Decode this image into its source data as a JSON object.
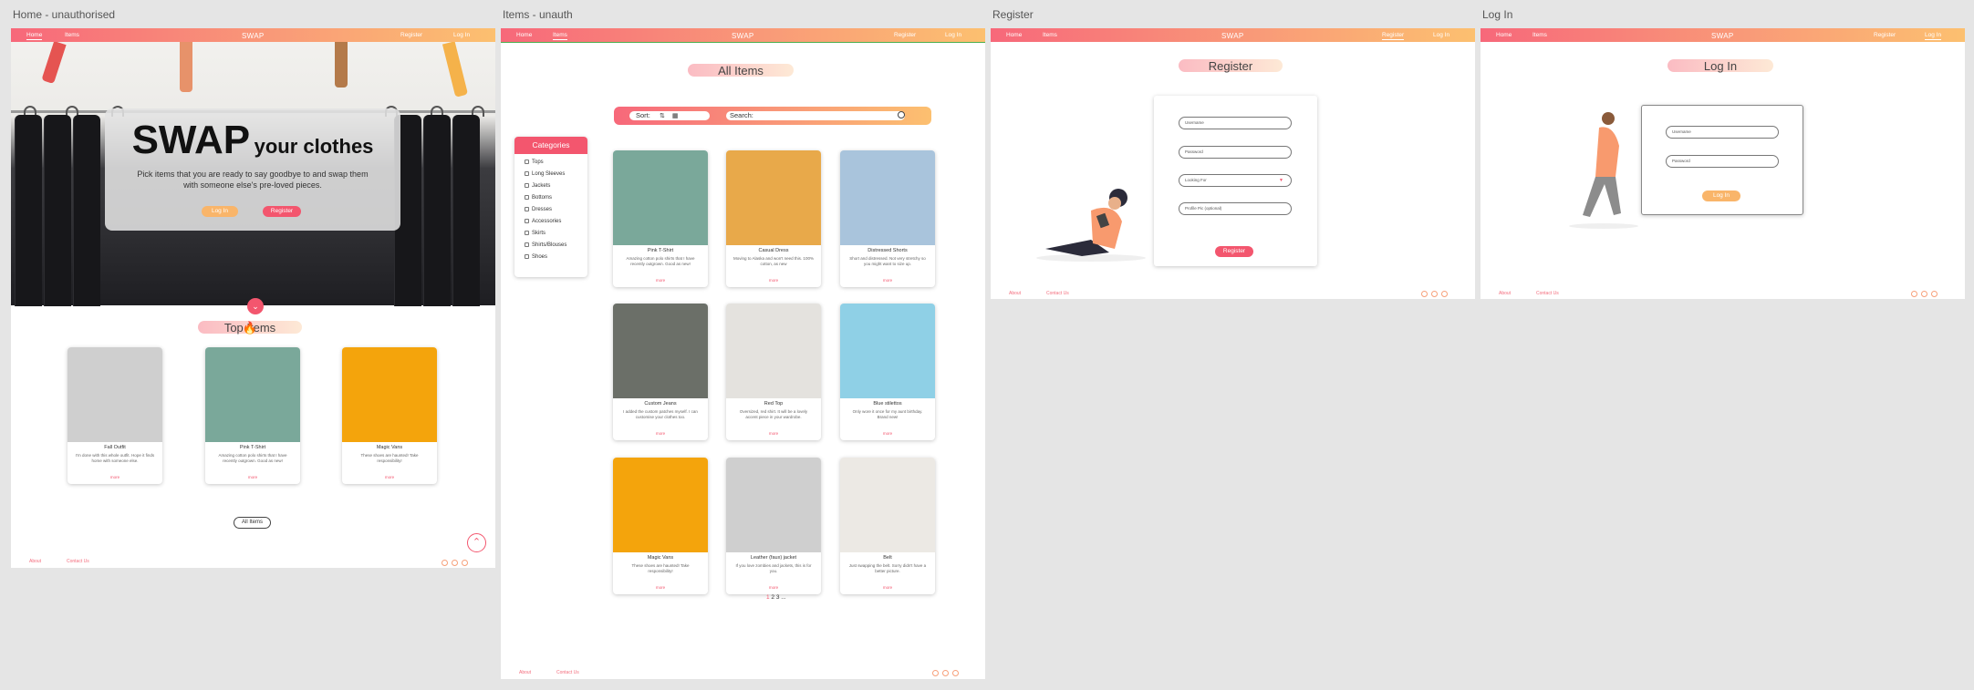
{
  "boards": {
    "home": {
      "label": "Home - unauthorised"
    },
    "items": {
      "label": "Items - unauth"
    },
    "register": {
      "label": "Register"
    },
    "login": {
      "label": "Log In"
    }
  },
  "nav": {
    "home": "Home",
    "items": "Items",
    "register": "Register",
    "login": "Log In",
    "logo": "SWAP"
  },
  "footer": {
    "about": "About",
    "contact": "Contact Us"
  },
  "hero": {
    "title_big": "SWAP",
    "title_small": "your clothes",
    "subtitle": "Pick items that you are ready to say goodbye to and swap them with someone else's pre-loved pieces.",
    "login_btn": "Log In",
    "register_btn": "Register"
  },
  "top_items": {
    "title": "Top Items",
    "cards": [
      {
        "name": "Fall Outfit",
        "desc": "I'm done with this whole outfit. Hope it finds home with someone else.",
        "more": "more",
        "color": "#cfcfcf"
      },
      {
        "name": "Pink T-Shirt",
        "desc": "Amazing cotton polo shirts that I have recently outgrown. Good as new!",
        "more": "more",
        "color": "#7aa89a"
      },
      {
        "name": "Magic Vans",
        "desc": "These shoes are haunted! Take responsibility!",
        "more": "more",
        "color": "#f4a40c"
      }
    ],
    "all_items_btn": "All Items"
  },
  "items_page": {
    "title": "All Items",
    "sort_label": "Sort:",
    "search_placeholder": "Search:",
    "categories_title": "Categories",
    "categories": [
      "Tops",
      "Long Sleeves",
      "Jackets",
      "Bottoms",
      "Dresses",
      "Accessories",
      "Skirts",
      "Shirts/Blouses",
      "Shoes"
    ],
    "products": [
      {
        "name": "Pink T-Shirt",
        "desc": "Amazing cotton polo shirts that I have recently outgrown. Good as new!",
        "more": "more",
        "color": "#7aa89a"
      },
      {
        "name": "Casual Dress",
        "desc": "Moving to Alaska and won't need this. 100% cotton, as new",
        "more": "more",
        "color": "#e8a94a"
      },
      {
        "name": "Distressed Shorts",
        "desc": "Short and distressed. Not very stretchy so you might want to size up.",
        "more": "more",
        "color": "#a9c4dc"
      },
      {
        "name": "Custom Jeans",
        "desc": "I added the custom patches myself. I can customise your clothes too.",
        "more": "more",
        "color": "#6b6f68"
      },
      {
        "name": "Red Top",
        "desc": "Oversized, red shirt. It will be a lovely accent piece in your wardrobe.",
        "more": "more",
        "color": "#e4e2de"
      },
      {
        "name": "Blue stilettos",
        "desc": "Only wore it once for my aunt birthday. Brand new!",
        "more": "more",
        "color": "#8fd0e6"
      },
      {
        "name": "Magic Vans",
        "desc": "These shoes are haunted! Take responsibility!",
        "more": "more",
        "color": "#f4a40c"
      },
      {
        "name": "Leather (faux) jacket",
        "desc": "If you love zombies and jackets, this is for you.",
        "more": "more",
        "color": "#cfcfcf"
      },
      {
        "name": "Belt",
        "desc": "Just swapping the belt. Sorry didn't have a better picture.",
        "more": "more",
        "color": "#ece9e4"
      }
    ],
    "pager_active": "1",
    "pager_rest": " 2 3 ..."
  },
  "register_page": {
    "title": "Register",
    "fields": [
      "Username",
      "Password",
      "Looking For",
      "Profile Pic (optional)"
    ],
    "submit": "Register"
  },
  "login_page": {
    "title": "Log In",
    "fields": [
      "Username",
      "Password"
    ],
    "submit": "Log In"
  },
  "colors": {
    "accent": "#f3566e",
    "gradient_start": "#f7687a",
    "gradient_end": "#fcc070",
    "button_yellow": "#f9b56a"
  }
}
